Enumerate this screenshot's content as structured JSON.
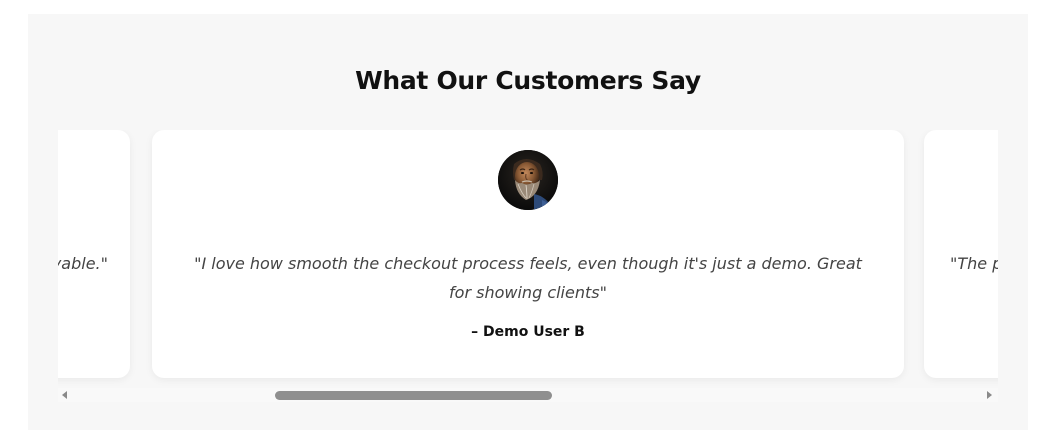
{
  "section": {
    "title": "What Our Customers Say"
  },
  "testimonials": {
    "left": {
      "quote_visible": "yable.\""
    },
    "center": {
      "avatar_icon": "bearded-man-avatar",
      "quote": "\"I love how smooth the checkout process feels, even though it's just a demo. Great for showing clients\"",
      "author": "– Demo User B"
    },
    "right": {
      "quote_visible": "\"The p"
    }
  },
  "colors": {
    "section_bg": "#f7f7f7",
    "card_bg": "#ffffff",
    "quote_text": "#444444",
    "heading_text": "#111111",
    "scroll_thumb": "#8f8f8f"
  },
  "scroll": {
    "thumb_position_fraction": 0.23
  }
}
